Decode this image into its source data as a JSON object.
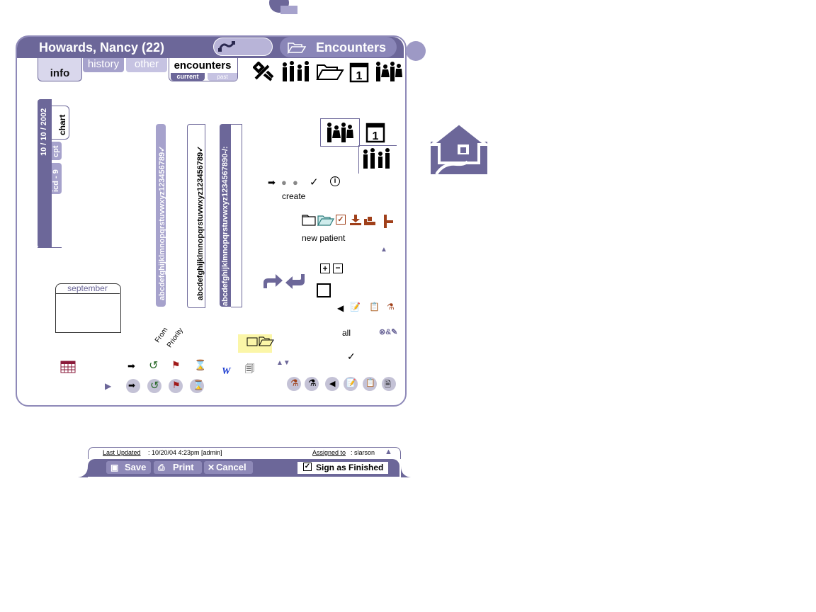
{
  "patient": {
    "name": "Howards, Nancy (22)"
  },
  "section": {
    "title": "Encounters"
  },
  "tabs": {
    "info": "info",
    "history": "history",
    "other": "other",
    "encounters": "encounters",
    "current": "current",
    "past": "past"
  },
  "side_tabs": {
    "date": "10 / 10 / 2002",
    "chart": "chart",
    "cpt": "cpt",
    "icd": "icd - 9"
  },
  "calendar": {
    "month": "september"
  },
  "alphabet": {
    "bar1": "abcdefghijklmnopqrstuvwxyz123456789✓",
    "bar2": "abcdefghijklmnopqrstuvwxyz123456789✓",
    "bar3": "abcdefghijklmnopqrstuvwxyz1234567890-/:"
  },
  "labels": {
    "create": "create",
    "new_patient": "new patient",
    "all": "all",
    "from": "From",
    "priority": "Priority"
  },
  "footer": {
    "last_updated_label": "Last Updated",
    "last_updated_value": ": 10/20/04 4:23pm [admin]",
    "assigned_label": "Assigned to",
    "assigned_value": ": slarson",
    "save": "Save",
    "print": "Print",
    "cancel": "Cancel",
    "sign": "Sign as Finished"
  },
  "colors": {
    "primary": "#6c6799",
    "light": "#a6a2cc",
    "accent_brown": "#a0401a",
    "highlight": "#fbf6a8"
  }
}
